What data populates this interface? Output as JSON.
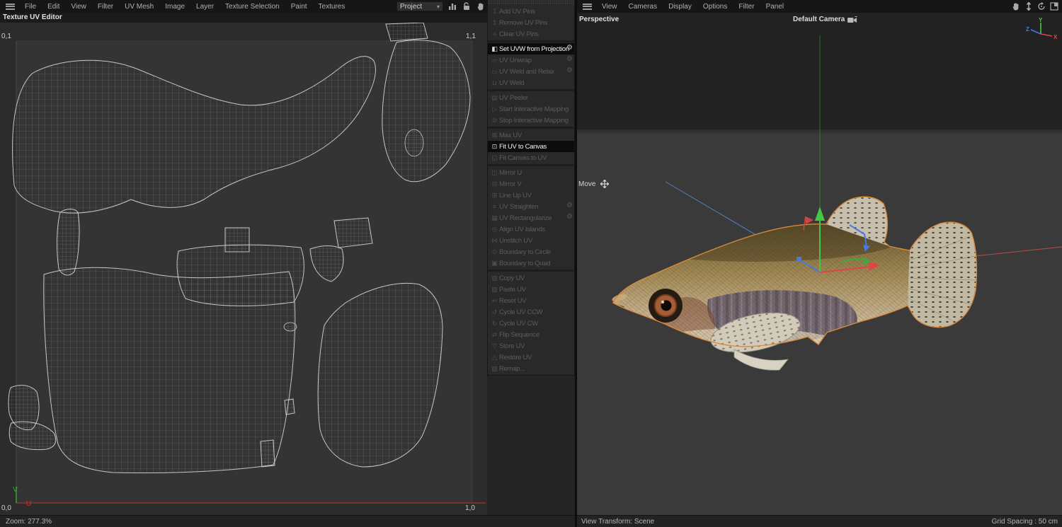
{
  "uv_editor": {
    "menu": [
      "File",
      "Edit",
      "View",
      "Filter",
      "UV Mesh",
      "Image",
      "Layer",
      "Texture Selection",
      "Paint",
      "Textures"
    ],
    "toolbar": {
      "project_label": "Project",
      "icons": [
        "histogram-icon",
        "lock-icon",
        "hand-icon",
        "frame-all-icon"
      ]
    },
    "title": "Texture UV Editor",
    "corner_labels": {
      "top_left": "0,1",
      "top_right": "1,1",
      "bottom_left": "0,0",
      "bottom_right": "1,0"
    },
    "axis_labels": {
      "u": "U",
      "v": "V"
    },
    "status_zoom": "Zoom: 277.3%"
  },
  "uv_commands": {
    "gear_icon": "gear-icon",
    "groups": [
      {
        "items": [
          {
            "label": "Add UV Pins",
            "icon": "add-pin-icon",
            "enabled": false
          },
          {
            "label": "Remove UV Pins",
            "icon": "remove-pin-icon",
            "enabled": false
          },
          {
            "label": "Clear UV Pins",
            "icon": "clear-pins-icon",
            "enabled": false
          }
        ]
      },
      {
        "items": [
          {
            "label": "Set UVW from Projection",
            "icon": "set-uvw-icon",
            "enabled": true,
            "gear": true
          },
          {
            "label": "UV Unwrap",
            "icon": "unwrap-icon",
            "enabled": false,
            "gear": true
          },
          {
            "label": "UV Weld and Relax",
            "icon": "weld-relax-icon",
            "enabled": false,
            "gear": true
          },
          {
            "label": "UV Weld",
            "icon": "weld-icon",
            "enabled": false
          }
        ]
      },
      {
        "items": [
          {
            "label": "UV Peeler",
            "icon": "peeler-icon",
            "enabled": false
          },
          {
            "label": "Start Interactive Mapping",
            "icon": "play-icon",
            "enabled": false
          },
          {
            "label": "Stop Interactive Mapping",
            "icon": "stop-icon",
            "enabled": false
          }
        ]
      },
      {
        "items": [
          {
            "label": "Max UV",
            "icon": "max-uv-icon",
            "enabled": false
          },
          {
            "label": "Fit UV to Canvas",
            "icon": "fit-uv-icon",
            "enabled": true
          },
          {
            "label": "Fit Canvas to UV",
            "icon": "fit-canvas-icon",
            "enabled": false
          }
        ]
      },
      {
        "items": [
          {
            "label": "Mirror U",
            "icon": "mirror-u-icon",
            "enabled": false
          },
          {
            "label": "Mirror V",
            "icon": "mirror-v-icon",
            "enabled": false
          },
          {
            "label": "Line Up UV",
            "icon": "line-up-icon",
            "enabled": false
          },
          {
            "label": "UV Straighten",
            "icon": "straighten-icon",
            "enabled": false,
            "gear": true
          },
          {
            "label": "UV Rectangularize",
            "icon": "rectangularize-icon",
            "enabled": false,
            "gear": true
          },
          {
            "label": "Align UV Islands",
            "icon": "align-islands-icon",
            "enabled": false
          },
          {
            "label": "Unstitch UV",
            "icon": "unstitch-icon",
            "enabled": false
          },
          {
            "label": "Boundary to Circle",
            "icon": "boundary-circle-icon",
            "enabled": false
          },
          {
            "label": "Boundary to Quad",
            "icon": "boundary-quad-icon",
            "enabled": false
          }
        ]
      },
      {
        "items": [
          {
            "label": "Copy UV",
            "icon": "copy-icon",
            "enabled": false
          },
          {
            "label": "Paste UV",
            "icon": "paste-icon",
            "enabled": false
          },
          {
            "label": "Reset UV",
            "icon": "reset-icon",
            "enabled": false
          },
          {
            "label": "Cycle UV CCW",
            "icon": "cycle-ccw-icon",
            "enabled": false
          },
          {
            "label": "Cycle UV CW",
            "icon": "cycle-cw-icon",
            "enabled": false
          },
          {
            "label": "Flip Sequence",
            "icon": "flip-sequence-icon",
            "enabled": false
          },
          {
            "label": "Store UV",
            "icon": "store-icon",
            "enabled": false
          },
          {
            "label": "Restore UV",
            "icon": "restore-icon",
            "enabled": false
          },
          {
            "label": "Remap...",
            "icon": "remap-icon",
            "enabled": false
          }
        ]
      }
    ]
  },
  "viewport": {
    "menu": [
      "View",
      "Cameras",
      "Display",
      "Options",
      "Filter",
      "Panel"
    ],
    "toolbar_icons": [
      "hand-icon",
      "frame-all-icon",
      "reset-view-icon",
      "panel-layout-icon"
    ],
    "view_label": "Perspective",
    "camera_label": "Default Camera",
    "tool_label": "Move",
    "axis_gizmo": {
      "x": "X",
      "y": "Y",
      "z": "Z"
    },
    "status_left": "View Transform: Scene",
    "status_right": "Grid Spacing : 50 cm"
  },
  "colors": {
    "axis_x": "#e04545",
    "axis_y": "#43c843",
    "axis_z": "#4878e0",
    "u_axis": "#b03434",
    "v_axis": "#3aa83a",
    "selection_outline": "#d9893b",
    "wireframe": "#c2c2c2"
  }
}
